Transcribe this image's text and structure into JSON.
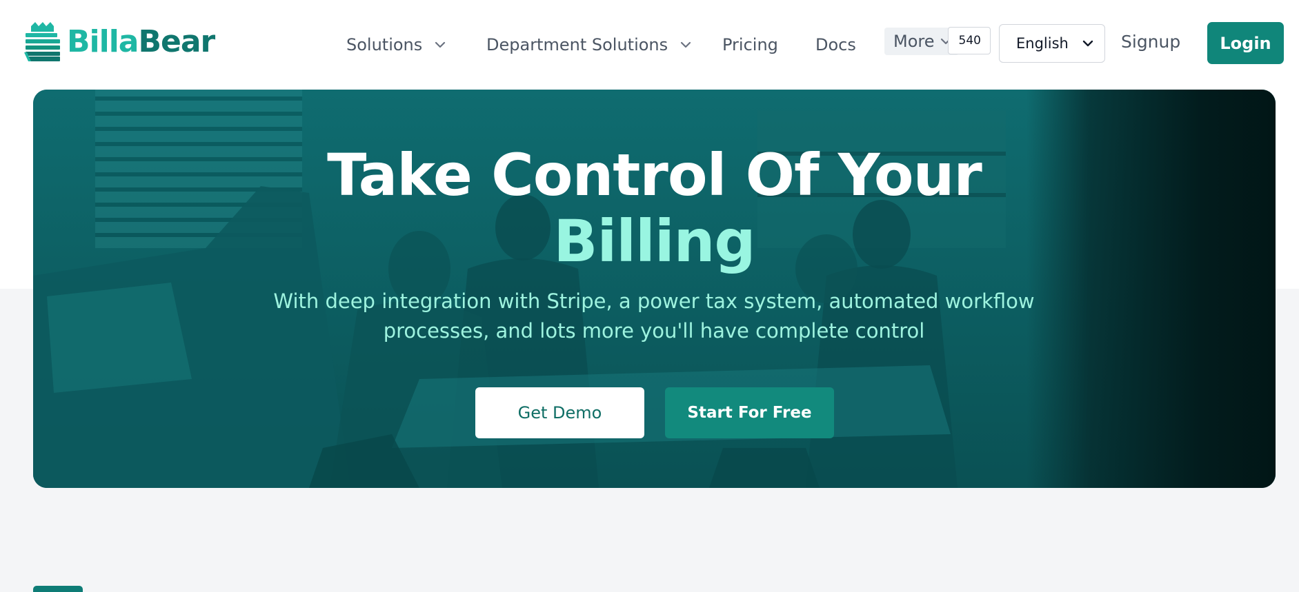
{
  "brand": {
    "name_part1": "Billa",
    "name_part2": "Bear",
    "color_light": "#1fb7a4",
    "color_dark": "#10766e"
  },
  "nav": {
    "items": [
      {
        "label": "Solutions",
        "has_dropdown": true
      },
      {
        "label": "Department Solutions",
        "has_dropdown": true
      },
      {
        "label": "Pricing",
        "has_dropdown": false
      },
      {
        "label": "Docs",
        "has_dropdown": false
      }
    ],
    "more_label": "More",
    "currency_partial": "540",
    "language": "English",
    "signup_label": "Signup",
    "login_label": "Login"
  },
  "hero": {
    "title_line1": "Take Control Of Your",
    "title_accent": "Billing",
    "subtitle": "With deep integration with Stripe, a power tax system, automated workflow processes, and lots more you'll have complete control",
    "cta_demo": "Get Demo",
    "cta_free": "Start For Free"
  },
  "colors": {
    "primary": "#10867a",
    "accent_text": "#99f5e1",
    "page_bg": "#f4f5f7"
  },
  "icons": {
    "chevron": "chevron-down-icon",
    "logo": "billabear-logo-icon"
  }
}
